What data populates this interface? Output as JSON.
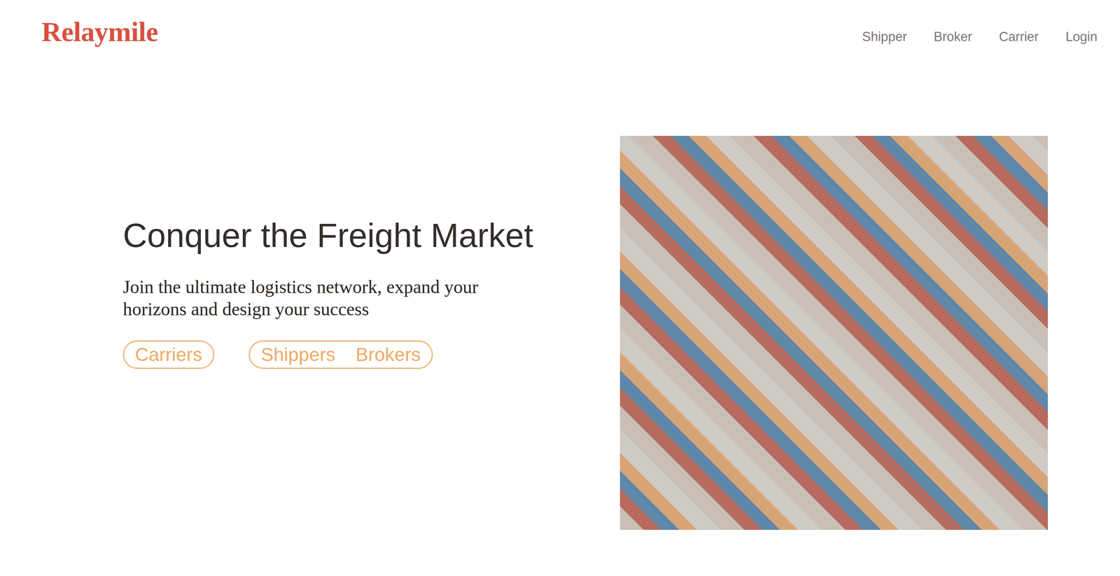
{
  "logo": {
    "text": "Relaymile"
  },
  "nav": [
    {
      "label": "Shipper"
    },
    {
      "label": "Broker"
    },
    {
      "label": "Carrier"
    },
    {
      "label": "Login"
    }
  ],
  "hero": {
    "title": "Conquer the Freight Market",
    "subtitle": "Join the ultimate logistics network, expand your horizons and design your success",
    "buttons": [
      {
        "labels": [
          "Carriers"
        ]
      },
      {
        "labels": [
          "Shippers",
          "Brokers"
        ]
      }
    ]
  },
  "image": {
    "kind": "photo"
  }
}
